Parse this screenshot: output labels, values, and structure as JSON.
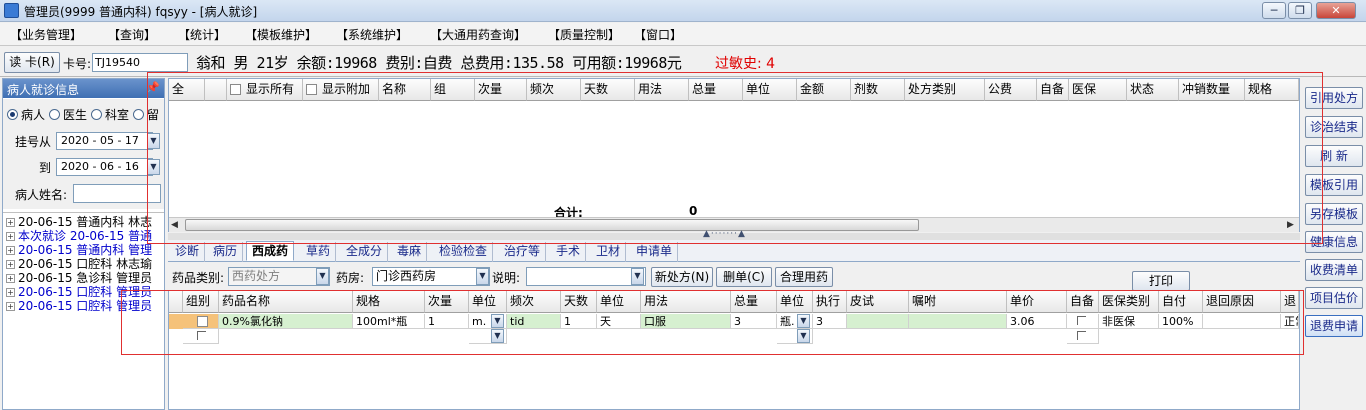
{
  "window": {
    "title": "管理员(9999 普通内科) fqsyy - [病人就诊]"
  },
  "menu": [
    "【业务管理】",
    "【查询】",
    "【统计】",
    "【模板维护】",
    "【系统维护】",
    "【大通用药查询】",
    "【质量控制】",
    "【窗口】"
  ],
  "infobar": {
    "read_card": "读 卡(R)",
    "card_label": "卡号:",
    "card_value": "TJ19540",
    "patient_text": "翁和 男 21岁 余额:19968 费别:自费 总费用:135.58 可用额:19968元",
    "allergy": "过敏史: 4"
  },
  "left_panel": {
    "title": "病人就诊信息",
    "radios": [
      "病人",
      "医生",
      "科室",
      "留"
    ],
    "reg_from_label": "挂号从",
    "reg_from": "2020 - 05 - 17",
    "to_label": "到",
    "reg_to": "2020 - 06 - 16",
    "name_label": "病人姓名:",
    "tree": [
      {
        "text": "20-06-15 普通内科 林志",
        "color": "#000000"
      },
      {
        "text": "本次就诊 20-06-15 普通",
        "color": "#0000cc"
      },
      {
        "text": "20-06-15 普通内科 管理",
        "color": "#0000cc"
      },
      {
        "text": "20-06-15 口腔科 林志瑜",
        "color": "#000000"
      },
      {
        "text": "20-06-15 急诊科 管理员",
        "color": "#000000"
      },
      {
        "text": "20-06-15 口腔科 管理员",
        "color": "#0000cc"
      },
      {
        "text": "20-06-15 口腔科 管理员",
        "color": "#0000cc"
      }
    ]
  },
  "top_grid": {
    "headers": [
      "全",
      "显示所有",
      "显示附加",
      "名称",
      "组",
      "次量",
      "频次",
      "天数",
      "用法",
      "总量",
      "单位",
      "金额",
      "剂数",
      "处方类别",
      "公费",
      "自备",
      "医保",
      "状态",
      "冲销数量",
      "规格"
    ],
    "total_label": "合计:",
    "total_value": "0"
  },
  "tabs": [
    "诊断",
    "病历",
    "西成药",
    "草药",
    "全成分",
    "毒麻",
    "检验检查",
    "治疗等",
    "手术",
    "卫材",
    "申请单"
  ],
  "active_tab": "西成药",
  "toolbar2": {
    "drug_type_label": "药品类别:",
    "drug_type_value": "西药处方",
    "pharmacy_label": "药房:",
    "pharmacy_value": "门诊西药房",
    "note_label": "说明:",
    "note_value": "",
    "new_rx": "新处方(N)",
    "delete_rx": "删单(C)",
    "rational_drug": "合理用药",
    "print": "打印"
  },
  "bottom_grid": {
    "headers": [
      "组别",
      "药品名称",
      "规格",
      "次量",
      "单位",
      "频次",
      "天数",
      "单位",
      "用法",
      "总量",
      "单位",
      "执行",
      "皮试",
      "嘱咐",
      "单价",
      "自备",
      "医保类别",
      "自付",
      "退回原因",
      "退"
    ],
    "row": {
      "name": "0.9%氯化钠",
      "spec": "100ml*瓶",
      "dose": "1",
      "dose_unit": "m.",
      "freq": "tid",
      "days": "1",
      "day_unit": "天",
      "usage": "口服",
      "total": "3",
      "total_unit": "瓶.",
      "exec": "3",
      "price": "3.06",
      "insurance_type": "非医保",
      "self_pay": "100%",
      "status": "正常"
    }
  },
  "right_buttons": [
    "引用处方",
    "诊治结束",
    "刷 新",
    "模板引用",
    "另存模板",
    "健康信息",
    "收费清单",
    "项目估价",
    "退费申请"
  ],
  "colors": {
    "accent": "#3f6fb3",
    "allergy": "#e00000",
    "row_green": "#d6f0d0",
    "annotation": "#e03030"
  }
}
